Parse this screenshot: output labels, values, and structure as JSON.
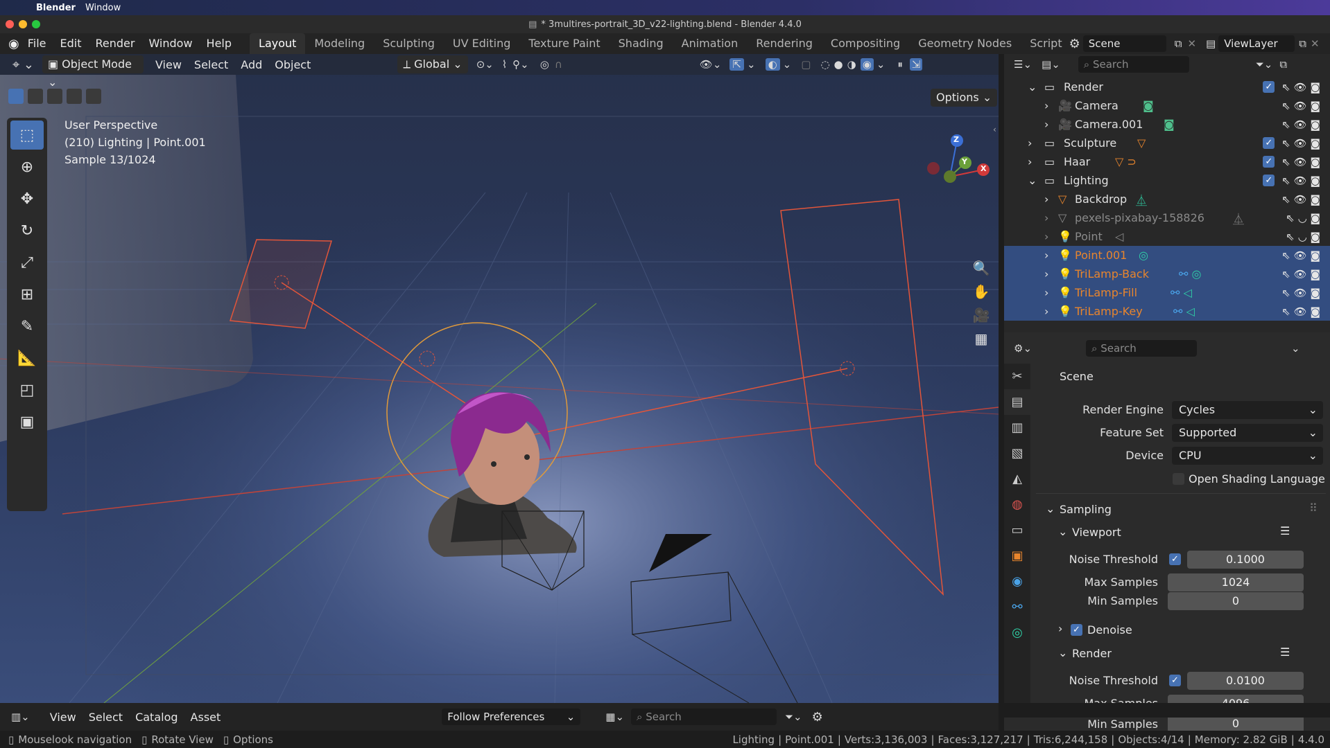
{
  "mac_menu": {
    "app": "Blender",
    "window": "Window"
  },
  "title": "* 3multires-portrait_3D_v22-lighting.blend - Blender 4.4.0",
  "top_menu": [
    "File",
    "Edit",
    "Render",
    "Window",
    "Help"
  ],
  "workspaces": [
    "Layout",
    "Modeling",
    "Sculpting",
    "UV Editing",
    "Texture Paint",
    "Shading",
    "Animation",
    "Rendering",
    "Compositing",
    "Geometry Nodes",
    "Script"
  ],
  "scene": {
    "name": "Scene",
    "view_layer": "ViewLayer"
  },
  "viewport_header": {
    "mode": "Object Mode",
    "menus": [
      "View",
      "Select",
      "Add",
      "Object"
    ],
    "transform": "Global",
    "options": "Options"
  },
  "viewport_info": {
    "line1": "User Perspective",
    "line2": "(210) Lighting | Point.001",
    "line3": "Sample 13/1024"
  },
  "gizmo": {
    "z": "Z",
    "y": "Y",
    "x": "X"
  },
  "outliner": {
    "search_placeholder": "Search",
    "rows": [
      {
        "name": "Render",
        "type": "collection"
      },
      {
        "name": "Camera",
        "type": "camera"
      },
      {
        "name": "Camera.001",
        "type": "camera"
      },
      {
        "name": "Sculpture",
        "type": "collection"
      },
      {
        "name": "Haar",
        "type": "collection"
      },
      {
        "name": "Lighting",
        "type": "collection"
      },
      {
        "name": "Backdrop",
        "type": "mesh"
      },
      {
        "name": "pexels-pixabay-158826",
        "type": "mesh"
      },
      {
        "name": "Point",
        "type": "light"
      },
      {
        "name": "Point.001",
        "type": "light"
      },
      {
        "name": "TriLamp-Back",
        "type": "light"
      },
      {
        "name": "TriLamp-Fill",
        "type": "light"
      },
      {
        "name": "TriLamp-Key",
        "type": "light"
      }
    ]
  },
  "properties": {
    "search_placeholder": "Search",
    "context": "Scene",
    "render_engine_label": "Render Engine",
    "render_engine": "Cycles",
    "feature_set_label": "Feature Set",
    "feature_set": "Supported",
    "device_label": "Device",
    "device": "CPU",
    "osl_label": "Open Shading Language",
    "sampling": "Sampling",
    "viewport": "Viewport",
    "noise_threshold_label": "Noise Threshold",
    "viewport_noise_threshold": "0.1000",
    "max_samples_label": "Max Samples",
    "viewport_max_samples": "1024",
    "min_samples_label": "Min Samples",
    "viewport_min_samples": "0",
    "denoise": "Denoise",
    "render": "Render",
    "render_noise_threshold": "0.0100",
    "render_max_samples": "4096",
    "render_min_samples": "0"
  },
  "asset_bar": {
    "menus": [
      "View",
      "Select",
      "Catalog",
      "Asset"
    ],
    "library": "Follow Preferences",
    "search_placeholder": "Search"
  },
  "status": {
    "hints": [
      "Mouselook navigation",
      "Rotate View",
      "Options"
    ],
    "info": [
      "Lighting",
      "Point.001",
      "Verts:3,136,003",
      "Faces:3,127,217",
      "Tris:6,244,158",
      "Objects:4/14",
      "Memory: 2.82 GiB",
      "4.4.0"
    ]
  }
}
